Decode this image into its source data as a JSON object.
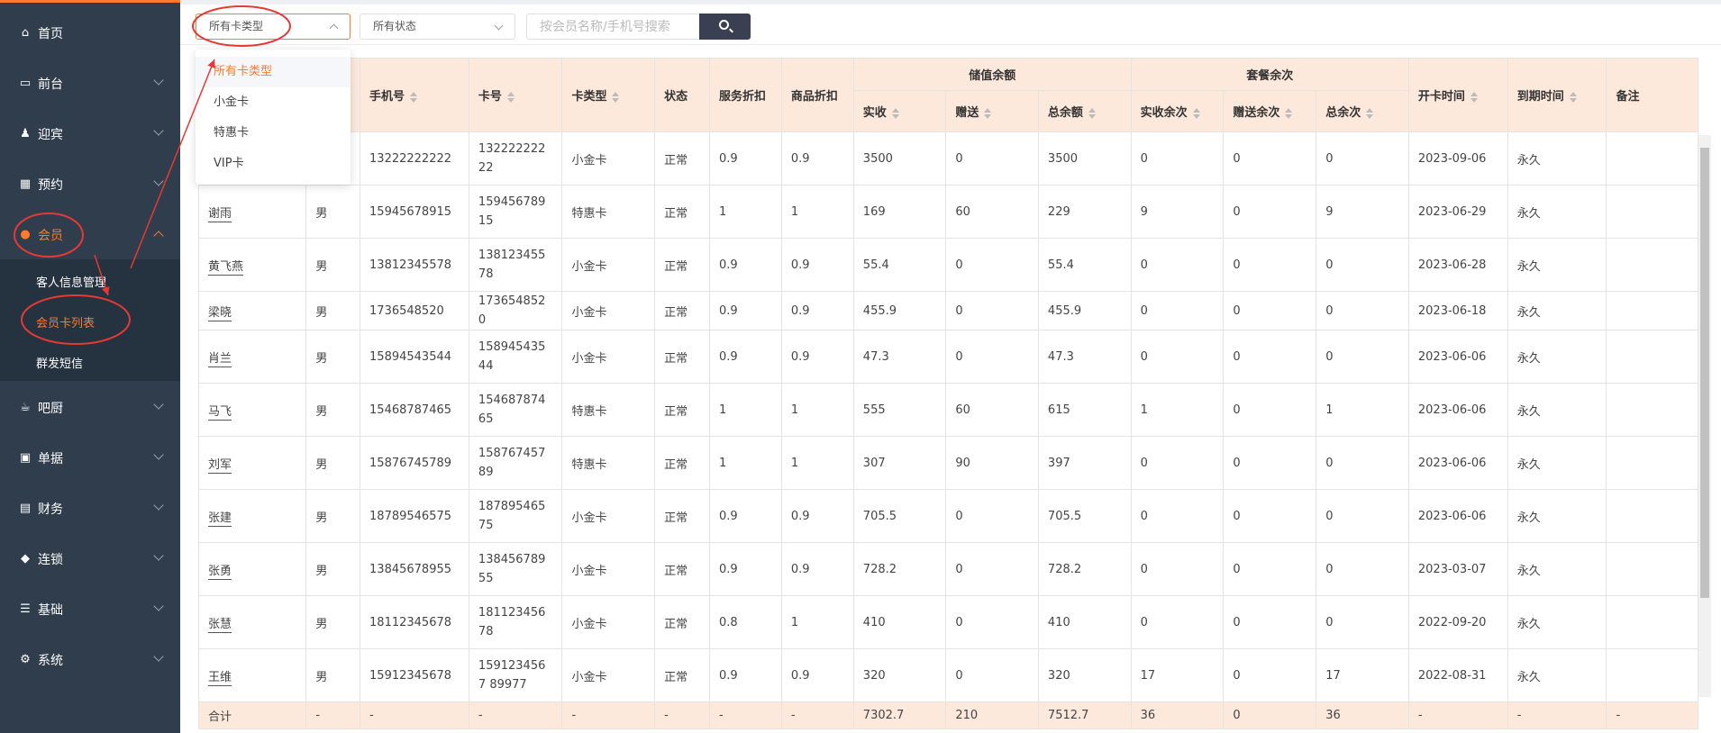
{
  "sidebar": {
    "items": [
      {
        "label": "首页",
        "icon": "home-icon"
      },
      {
        "label": "前台",
        "icon": "monitor-icon"
      },
      {
        "label": "迎宾",
        "icon": "reception-icon"
      },
      {
        "label": "预约",
        "icon": "calendar-icon"
      },
      {
        "label": "会员",
        "icon": "user-icon",
        "active": true
      },
      {
        "label": "吧厨",
        "icon": "cup-icon"
      },
      {
        "label": "单据",
        "icon": "clipboard-icon"
      },
      {
        "label": "财务",
        "icon": "finance-icon"
      },
      {
        "label": "连锁",
        "icon": "cube-icon"
      },
      {
        "label": "基础",
        "icon": "database-icon"
      },
      {
        "label": "系统",
        "icon": "gear-icon"
      }
    ],
    "submenu": [
      {
        "label": "客人信息管理"
      },
      {
        "label": "会员卡列表",
        "active": true
      },
      {
        "label": "群发短信"
      }
    ],
    "accent_color": "#ff7a2d",
    "bg_color": "#2f3d4c"
  },
  "toolbar": {
    "card_type_select": "所有卡类型",
    "status_select": "所有状态",
    "search_placeholder": "按会员名称/手机号搜索"
  },
  "dropdown": {
    "options": [
      "所有卡类型",
      "小金卡",
      "特惠卡",
      "VIP卡"
    ],
    "selected": "所有卡类型"
  },
  "table": {
    "headers": {
      "phone": "手机号",
      "card_no": "卡号",
      "card_type": "卡类型",
      "status": "状态",
      "service_discount": "服务折扣",
      "goods_discount": "商品折扣",
      "stored_group": "储值余额",
      "stored_paid": "实收",
      "stored_gift": "赠送",
      "stored_total": "总余额",
      "package_group": "套餐余次",
      "package_paid": "实收余次",
      "package_gift": "赠送余次",
      "package_total": "总余次",
      "open_time": "开卡时间",
      "expire_time": "到期时间",
      "remark": "备注"
    },
    "rows": [
      {
        "name": "",
        "gender": "",
        "phone": "13222222222",
        "card_no": "13222222222",
        "card_type": "小金卡",
        "status": "正常",
        "sd": "0.9",
        "gd": "0.9",
        "sp": "3500",
        "sg": "0",
        "st": "3500",
        "pp": "0",
        "pg": "0",
        "pt": "0",
        "open": "2023-09-06",
        "expire": "永久",
        "remark": ""
      },
      {
        "name": "谢雨",
        "gender": "男",
        "phone": "15945678915",
        "card_no": "15945678915",
        "card_type": "特惠卡",
        "status": "正常",
        "sd": "1",
        "gd": "1",
        "sp": "169",
        "sg": "60",
        "st": "229",
        "pp": "9",
        "pg": "0",
        "pt": "9",
        "open": "2023-06-29",
        "expire": "永久",
        "remark": ""
      },
      {
        "name": "黄飞燕",
        "gender": "男",
        "phone": "13812345578",
        "card_no": "13812345578",
        "card_type": "小金卡",
        "status": "正常",
        "sd": "0.9",
        "gd": "0.9",
        "sp": "55.4",
        "sg": "0",
        "st": "55.4",
        "pp": "0",
        "pg": "0",
        "pt": "0",
        "open": "2023-06-28",
        "expire": "永久",
        "remark": ""
      },
      {
        "name": "梁晓",
        "gender": "男",
        "phone": "1736548520",
        "card_no": "1736548520",
        "card_type": "小金卡",
        "status": "正常",
        "sd": "0.9",
        "gd": "0.9",
        "sp": "455.9",
        "sg": "0",
        "st": "455.9",
        "pp": "0",
        "pg": "0",
        "pt": "0",
        "open": "2023-06-18",
        "expire": "永久",
        "remark": ""
      },
      {
        "name": "肖兰",
        "gender": "男",
        "phone": "15894543544",
        "card_no": "15894543544",
        "card_type": "小金卡",
        "status": "正常",
        "sd": "0.9",
        "gd": "0.9",
        "sp": "47.3",
        "sg": "0",
        "st": "47.3",
        "pp": "0",
        "pg": "0",
        "pt": "0",
        "open": "2023-06-06",
        "expire": "永久",
        "remark": ""
      },
      {
        "name": "马飞",
        "gender": "男",
        "phone": "15468787465",
        "card_no": "15468787465",
        "card_type": "特惠卡",
        "status": "正常",
        "sd": "1",
        "gd": "1",
        "sp": "555",
        "sg": "60",
        "st": "615",
        "pp": "1",
        "pg": "0",
        "pt": "1",
        "open": "2023-06-06",
        "expire": "永久",
        "remark": ""
      },
      {
        "name": "刘军",
        "gender": "男",
        "phone": "15876745789",
        "card_no": "15876745789",
        "card_type": "特惠卡",
        "status": "正常",
        "sd": "1",
        "gd": "1",
        "sp": "307",
        "sg": "90",
        "st": "397",
        "pp": "0",
        "pg": "0",
        "pt": "0",
        "open": "2023-06-06",
        "expire": "永久",
        "remark": ""
      },
      {
        "name": "张建",
        "gender": "男",
        "phone": "18789546575",
        "card_no": "18789546575",
        "card_type": "小金卡",
        "status": "正常",
        "sd": "0.9",
        "gd": "0.9",
        "sp": "705.5",
        "sg": "0",
        "st": "705.5",
        "pp": "0",
        "pg": "0",
        "pt": "0",
        "open": "2023-06-06",
        "expire": "永久",
        "remark": ""
      },
      {
        "name": "张勇",
        "gender": "男",
        "phone": "13845678955",
        "card_no": "13845678955",
        "card_type": "小金卡",
        "status": "正常",
        "sd": "0.9",
        "gd": "0.9",
        "sp": "728.2",
        "sg": "0",
        "st": "728.2",
        "pp": "0",
        "pg": "0",
        "pt": "0",
        "open": "2023-03-07",
        "expire": "永久",
        "remark": ""
      },
      {
        "name": "张慧",
        "gender": "男",
        "phone": "18112345678",
        "card_no": "18112345678",
        "card_type": "小金卡",
        "status": "正常",
        "sd": "0.8",
        "gd": "1",
        "sp": "410",
        "sg": "0",
        "st": "410",
        "pp": "0",
        "pg": "0",
        "pt": "0",
        "open": "2022-09-20",
        "expire": "永久",
        "remark": ""
      },
      {
        "name": "王维",
        "gender": "男",
        "phone": "15912345678",
        "card_no": "1591234567 89977",
        "card_type": "小金卡",
        "status": "正常",
        "sd": "0.9",
        "gd": "0.9",
        "sp": "320",
        "sg": "0",
        "st": "320",
        "pp": "17",
        "pg": "0",
        "pt": "17",
        "open": "2022-08-31",
        "expire": "永久",
        "remark": ""
      }
    ],
    "total": {
      "name": "合计",
      "gender": "-",
      "phone": "-",
      "card_no": "-",
      "card_type": "-",
      "status": "-",
      "sd": "-",
      "gd": "-",
      "sp": "7302.7",
      "sg": "210",
      "st": "7512.7",
      "pp": "36",
      "pg": "0",
      "pt": "36",
      "open": "-",
      "expire": "-",
      "remark": "-"
    },
    "header_bg": "#fde8dc"
  },
  "annotation_color": "#e53935"
}
